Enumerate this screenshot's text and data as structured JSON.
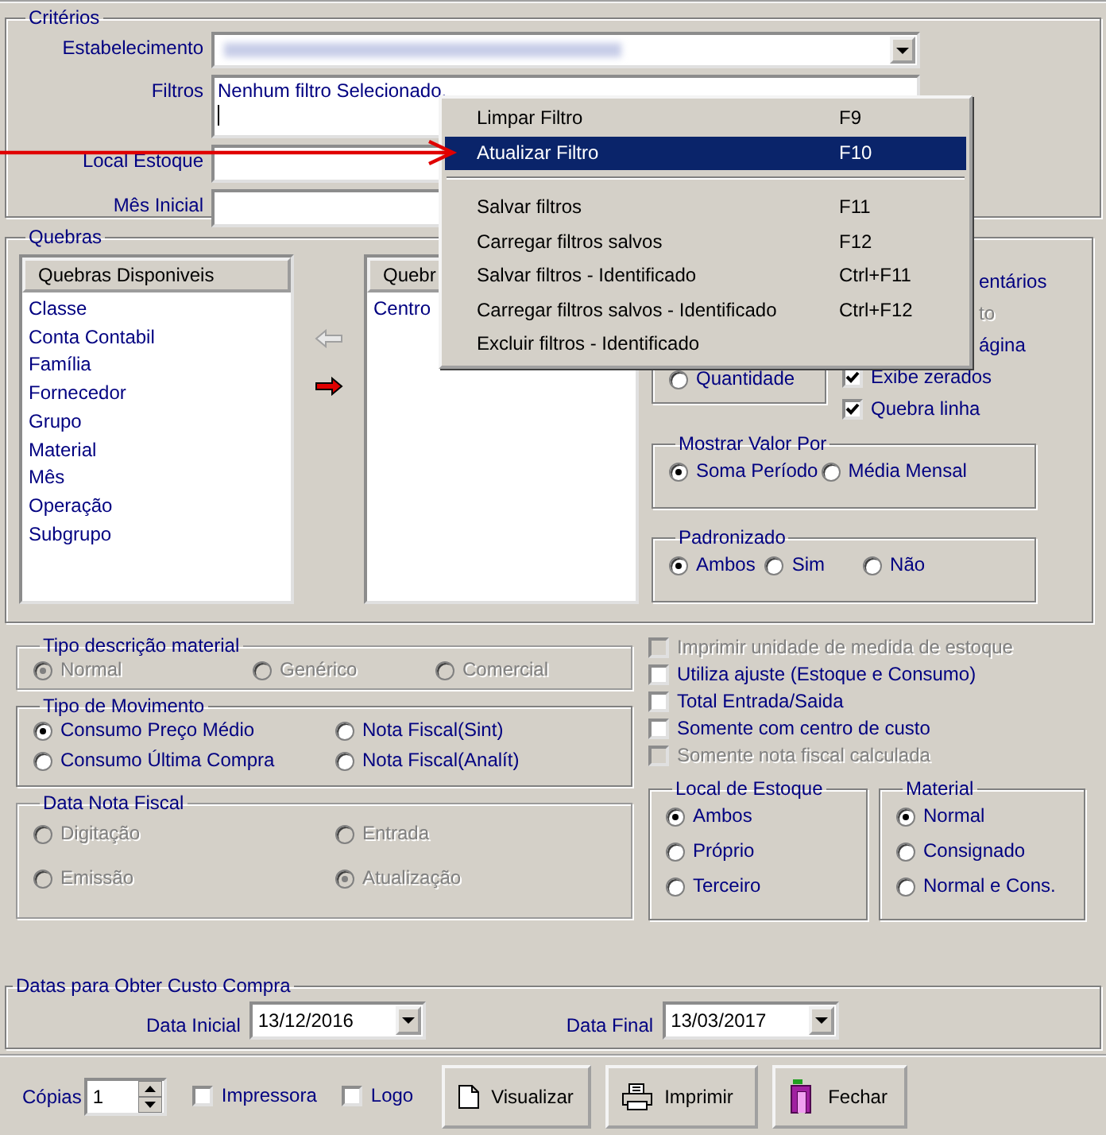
{
  "criterios": {
    "title": "Critérios",
    "fields": [
      {
        "label": "Estabelecimento",
        "kind": "combo",
        "blurred": true
      },
      {
        "label": "Filtros",
        "kind": "memo",
        "value": "Nenhum filtro Selecionado."
      },
      {
        "label": "Local Estoque",
        "kind": "text"
      },
      {
        "label": "Mês Inicial",
        "kind": "text"
      }
    ]
  },
  "context_menu": {
    "items": [
      {
        "kind": "item",
        "label": "Limpar Filtro",
        "shortcut": "F9",
        "selected": false
      },
      {
        "kind": "item",
        "label": "Atualizar Filtro",
        "shortcut": "F10",
        "selected": true
      },
      {
        "kind": "separator"
      },
      {
        "kind": "item",
        "label": "Salvar filtros",
        "shortcut": "F11",
        "selected": false
      },
      {
        "kind": "item",
        "label": "Carregar filtros salvos",
        "shortcut": "F12",
        "selected": false
      },
      {
        "kind": "item",
        "label": "Salvar filtros - Identificado",
        "shortcut": "Ctrl+F11",
        "selected": false
      },
      {
        "kind": "item",
        "label": "Carregar filtros salvos - Identificado",
        "shortcut": "Ctrl+F12",
        "selected": false
      },
      {
        "kind": "item",
        "label": "Excluir filtros - Identificado",
        "selected": false
      }
    ]
  },
  "quebras": {
    "title": "Quebras",
    "available": {
      "header": "Quebras Disponiveis",
      "items": [
        "Classe",
        "Conta Contabil",
        "Família",
        "Fornecedor",
        "Grupo",
        "Material",
        "Mês",
        "Operação",
        "Subgrupo"
      ]
    },
    "chosen": {
      "header": "Quebr",
      "items": [
        "Centro"
      ]
    },
    "value_type": {
      "options": [
        {
          "label": "Quantidade",
          "selected": false
        }
      ]
    },
    "options": [
      {
        "kind": "partial",
        "label": "entários",
        "disabled": false
      },
      {
        "kind": "partial",
        "label": "to",
        "disabled": true
      },
      {
        "kind": "partial",
        "label": "ágina",
        "disabled": false
      },
      {
        "kind": "full",
        "label": "Exibe zerados",
        "checked": true,
        "disabled": false
      },
      {
        "kind": "full",
        "label": "Quebra linha",
        "checked": true,
        "disabled": false
      }
    ],
    "mostrar_valor_por": {
      "title": "Mostrar Valor Por",
      "options": [
        {
          "label": "Soma Período",
          "selected": true
        },
        {
          "label": "Média Mensal",
          "selected": false
        }
      ]
    },
    "padronizado": {
      "title": "Padronizado",
      "options": [
        {
          "label": "Ambos",
          "selected": true
        },
        {
          "label": "Sim",
          "selected": false
        },
        {
          "label": "Não",
          "selected": false
        }
      ]
    }
  },
  "tipo_descricao_material": {
    "title": "Tipo descrição material",
    "disabled": true,
    "options": [
      {
        "label": "Normal",
        "selected": true
      },
      {
        "label": "Genérico",
        "selected": false
      },
      {
        "label": "Comercial",
        "selected": false
      }
    ]
  },
  "tipo_de_movimento": {
    "title": "Tipo de Movimento",
    "disabled": false,
    "options": [
      {
        "label": "Consumo Preço Médio",
        "selected": true
      },
      {
        "label": "Nota Fiscal(Sint)",
        "selected": false
      },
      {
        "label": "Consumo Última Compra",
        "selected": false
      },
      {
        "label": "Nota Fiscal(Analít)",
        "selected": false
      }
    ]
  },
  "data_nota_fiscal": {
    "title": "Data Nota Fiscal",
    "disabled": true,
    "options": [
      {
        "label": "Digitação",
        "selected": false
      },
      {
        "label": "Entrada",
        "selected": false
      },
      {
        "label": "Emissão",
        "selected": false
      },
      {
        "label": "Atualização",
        "selected": true
      }
    ]
  },
  "flags": [
    {
      "label": "Imprimir unidade de medida de estoque",
      "checked": false,
      "disabled": true
    },
    {
      "label": "Utiliza ajuste (Estoque e Consumo)",
      "checked": false,
      "disabled": false
    },
    {
      "label": "Total Entrada/Saida",
      "checked": false,
      "disabled": false
    },
    {
      "label": "Somente com centro de custo",
      "checked": false,
      "disabled": false
    },
    {
      "label": "Somente nota fiscal calculada",
      "checked": false,
      "disabled": true
    }
  ],
  "local_de_estoque": {
    "title": "Local de Estoque",
    "options": [
      {
        "label": "Ambos",
        "selected": true
      },
      {
        "label": "Próprio",
        "selected": false
      },
      {
        "label": "Terceiro",
        "selected": false
      }
    ]
  },
  "material": {
    "title": "Material",
    "options": [
      {
        "label": "Normal",
        "selected": true
      },
      {
        "label": "Consignado",
        "selected": false
      },
      {
        "label": "Normal e Cons.",
        "selected": false
      }
    ]
  },
  "datas": {
    "title": "Datas para Obter Custo Compra",
    "fields": [
      {
        "label": "Data Inicial",
        "value": "13/12/2016"
      },
      {
        "label": "Data Final",
        "value": "13/03/2017"
      }
    ]
  },
  "footer": {
    "copies_label": "Cópias",
    "copies": "1",
    "checkboxes": [
      {
        "label": "Impressora",
        "checked": false
      },
      {
        "label": "Logo",
        "checked": false
      }
    ],
    "buttons": [
      {
        "label": "Visualizar",
        "kind": "preview"
      },
      {
        "label": "Imprimir",
        "kind": "print"
      },
      {
        "label": "Fechar",
        "kind": "close"
      }
    ]
  }
}
